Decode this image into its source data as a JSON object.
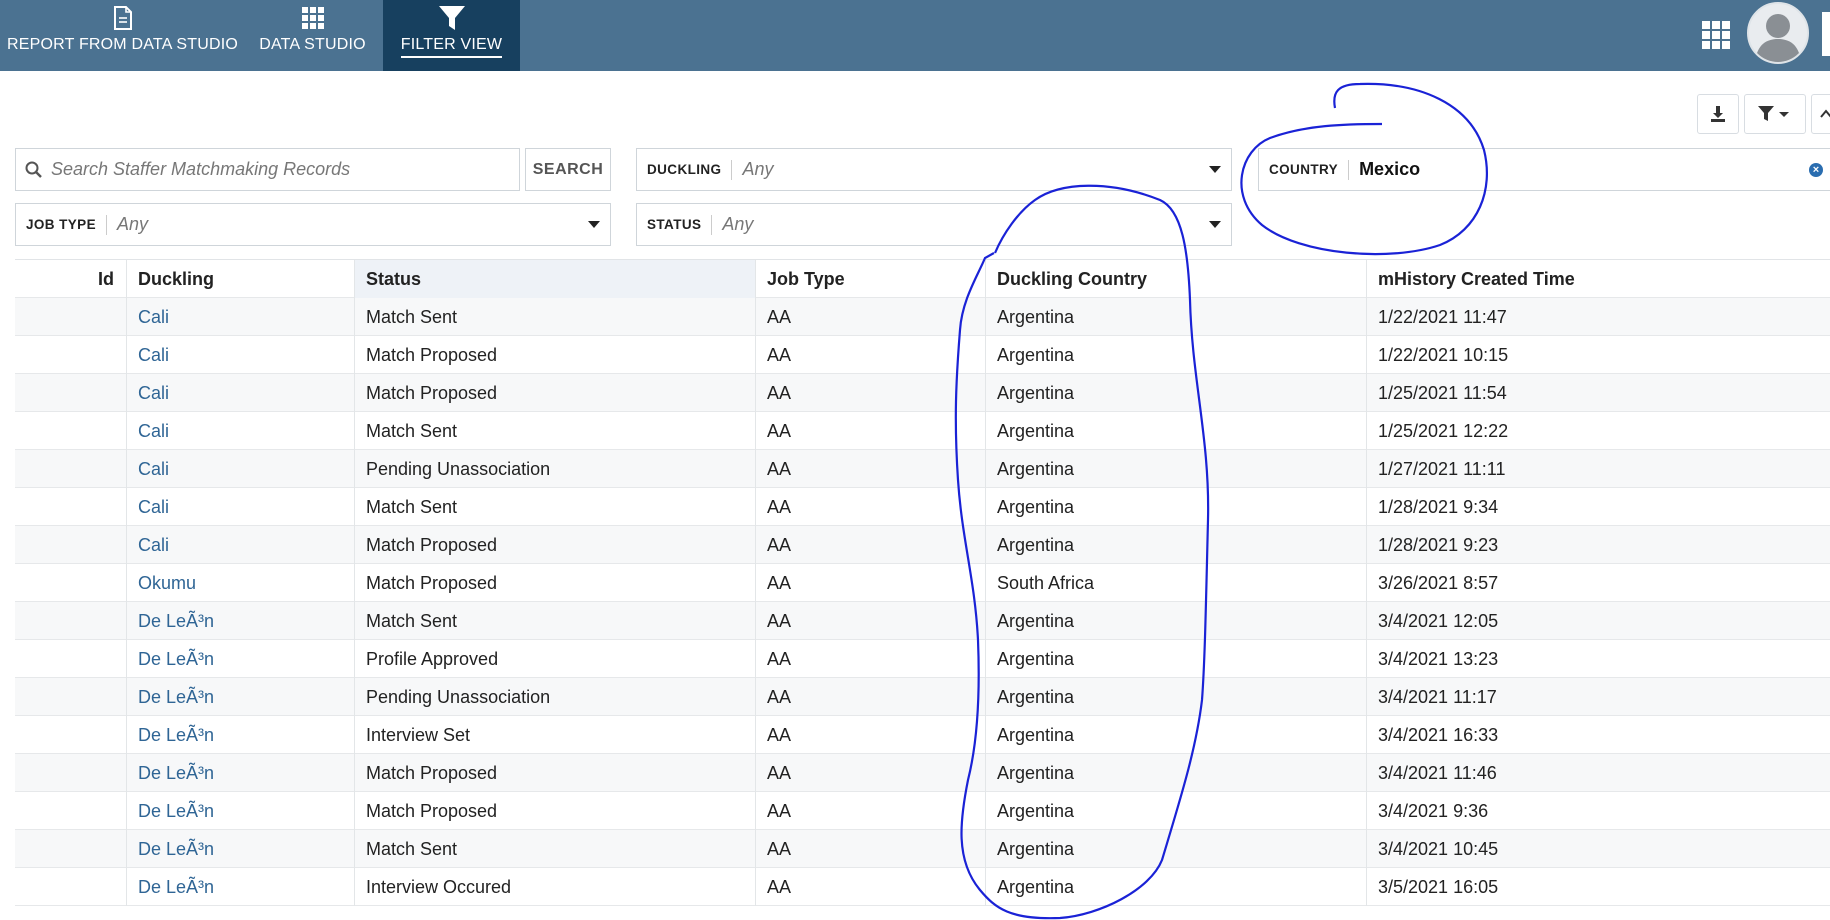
{
  "nav": {
    "tabs": [
      {
        "label": "REPORT FROM DATA STUDIO",
        "icon": "document-icon"
      },
      {
        "label": "DATA STUDIO",
        "icon": "grid-icon"
      },
      {
        "label": "FILTER VIEW",
        "icon": "filter-icon",
        "active": true
      }
    ]
  },
  "search": {
    "placeholder": "Search Staffer Matchmaking Records",
    "button_label": "SEARCH"
  },
  "filters": {
    "duckling": {
      "label": "DUCKLING",
      "value": "Any"
    },
    "country": {
      "label": "COUNTRY",
      "value": "Mexico"
    },
    "job_type": {
      "label": "JOB TYPE",
      "value": "Any"
    },
    "status": {
      "label": "STATUS",
      "value": "Any"
    }
  },
  "table": {
    "columns": [
      "Id",
      "Duckling",
      "Status",
      "Job Type",
      "Duckling Country",
      "mHistory Created Time"
    ],
    "rows": [
      {
        "id": "",
        "duckling": "Cali",
        "status": "Match Sent",
        "job_type": "AA",
        "country": "Argentina",
        "time": "1/22/2021 11:47"
      },
      {
        "id": "",
        "duckling": "Cali",
        "status": "Match Proposed",
        "job_type": "AA",
        "country": "Argentina",
        "time": "1/22/2021 10:15"
      },
      {
        "id": "",
        "duckling": "Cali",
        "status": "Match Proposed",
        "job_type": "AA",
        "country": "Argentina",
        "time": "1/25/2021 11:54"
      },
      {
        "id": "",
        "duckling": "Cali",
        "status": "Match Sent",
        "job_type": "AA",
        "country": "Argentina",
        "time": "1/25/2021 12:22"
      },
      {
        "id": "",
        "duckling": "Cali",
        "status": "Pending Unassociation",
        "job_type": "AA",
        "country": "Argentina",
        "time": "1/27/2021 11:11"
      },
      {
        "id": "",
        "duckling": "Cali",
        "status": "Match Sent",
        "job_type": "AA",
        "country": "Argentina",
        "time": "1/28/2021 9:34"
      },
      {
        "id": "",
        "duckling": "Cali",
        "status": "Match Proposed",
        "job_type": "AA",
        "country": "Argentina",
        "time": "1/28/2021 9:23"
      },
      {
        "id": "",
        "duckling": "Okumu",
        "status": "Match Proposed",
        "job_type": "AA",
        "country": "South Africa",
        "time": "3/26/2021 8:57"
      },
      {
        "id": "",
        "duckling": "De LeÃ³n",
        "status": "Match Sent",
        "job_type": "AA",
        "country": "Argentina",
        "time": "3/4/2021 12:05"
      },
      {
        "id": "",
        "duckling": "De LeÃ³n",
        "status": "Profile Approved",
        "job_type": "AA",
        "country": "Argentina",
        "time": "3/4/2021 13:23"
      },
      {
        "id": "",
        "duckling": "De LeÃ³n",
        "status": "Pending Unassociation",
        "job_type": "AA",
        "country": "Argentina",
        "time": "3/4/2021 11:17"
      },
      {
        "id": "",
        "duckling": "De LeÃ³n",
        "status": "Interview Set",
        "job_type": "AA",
        "country": "Argentina",
        "time": "3/4/2021 16:33"
      },
      {
        "id": "",
        "duckling": "De LeÃ³n",
        "status": "Match Proposed",
        "job_type": "AA",
        "country": "Argentina",
        "time": "3/4/2021 11:46"
      },
      {
        "id": "",
        "duckling": "De LeÃ³n",
        "status": "Match Proposed",
        "job_type": "AA",
        "country": "Argentina",
        "time": "3/4/2021 9:36"
      },
      {
        "id": "",
        "duckling": "De LeÃ³n",
        "status": "Match Sent",
        "job_type": "AA",
        "country": "Argentina",
        "time": "3/4/2021 10:45"
      },
      {
        "id": "",
        "duckling": "De LeÃ³n",
        "status": "Interview Occured",
        "job_type": "AA",
        "country": "Argentina",
        "time": "3/5/2021 16:05"
      }
    ]
  },
  "colors": {
    "topbar": "#4b7291",
    "active_tab": "#17405f",
    "link": "#2f6595",
    "annotation": "#1a22d6"
  }
}
